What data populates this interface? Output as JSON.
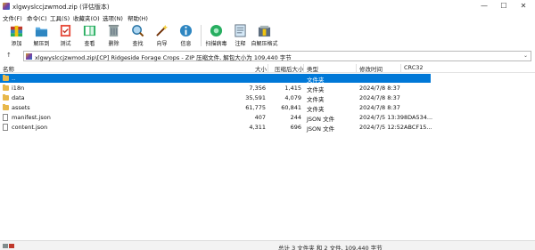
{
  "window": {
    "title": "xlgwyslccjzwmod.zip (评估版本)"
  },
  "menu": [
    "文件(F)",
    "命令(C)",
    "工具(S)",
    "收藏夹(O)",
    "选项(N)",
    "帮助(H)"
  ],
  "toolbar": {
    "add": "添加",
    "extract": "解压到",
    "test": "测试",
    "view": "查看",
    "delete": "删除",
    "find": "查找",
    "wizard": "向导",
    "info": "信息",
    "scan": "扫描病毒",
    "comment": "注释",
    "sfx": "自解压格式"
  },
  "address": {
    "path": "xlgwyslccjzwmod.zip\\[CP] Ridgeside Forage Crops - ZIP 压缩文件, 解包大小为 109,440 字节"
  },
  "columns": {
    "name": "名称",
    "size": "大小",
    "packed": "压缩后大小",
    "type": "类型",
    "modified": "修改时间",
    "crc": "CRC32"
  },
  "rows": [
    {
      "name": "..",
      "size": "",
      "packed": "",
      "type": "文件夹",
      "modified": "",
      "crc": "",
      "kind": "folder"
    },
    {
      "name": "i18n",
      "size": "7,356",
      "packed": "1,415",
      "type": "文件夹",
      "modified": "2024/7/8 8:37",
      "crc": "",
      "kind": "folder"
    },
    {
      "name": "data",
      "size": "35,591",
      "packed": "4,079",
      "type": "文件夹",
      "modified": "2024/7/8 8:37",
      "crc": "",
      "kind": "folder"
    },
    {
      "name": "assets",
      "size": "61,775",
      "packed": "60,841",
      "type": "文件夹",
      "modified": "2024/7/8 8:37",
      "crc": "",
      "kind": "folder"
    },
    {
      "name": "manifest.json",
      "size": "407",
      "packed": "244",
      "type": "JSON 文件",
      "modified": "2024/7/5 13:39",
      "crc": "8DA534...",
      "kind": "file"
    },
    {
      "name": "content.json",
      "size": "4,311",
      "packed": "696",
      "type": "JSON 文件",
      "modified": "2024/7/5 12:52",
      "crc": "ABCF15...",
      "kind": "file"
    }
  ],
  "status": {
    "text": "总计 3 文件夹 和 2 文件, 109,440 字节"
  },
  "colors": {
    "selection": "#0078d7",
    "folder": "#e8b84a"
  }
}
